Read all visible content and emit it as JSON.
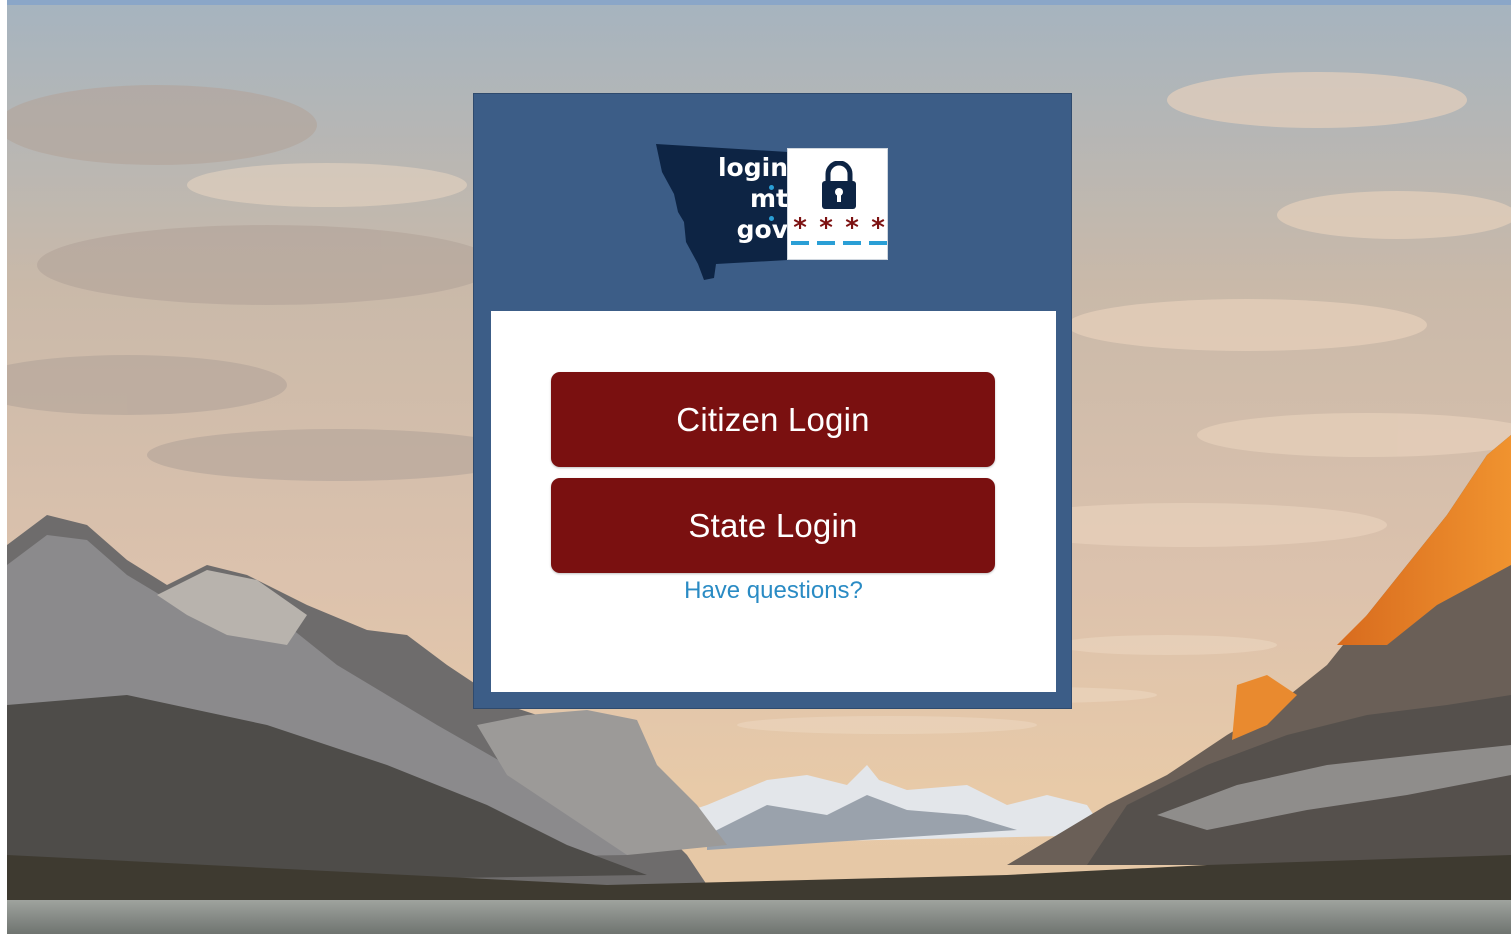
{
  "logo": {
    "words": [
      "login",
      "mt",
      "gov"
    ],
    "stars": [
      "*",
      "*",
      "*",
      "*"
    ]
  },
  "icons": {
    "state_outline": "montana-state-outline-icon",
    "lock": "padlock-icon",
    "background": "mountain-lake-landscape"
  },
  "buttons": {
    "citizen_login": "Citizen Login",
    "state_login": "State Login"
  },
  "help_link": "Have questions?",
  "colors": {
    "card": "#3c5d87",
    "button": "#7a1010",
    "link": "#2a8bc4",
    "logo_dark": "#0d2444",
    "logo_accent": "#2a9fd6",
    "star": "#7d1212"
  }
}
